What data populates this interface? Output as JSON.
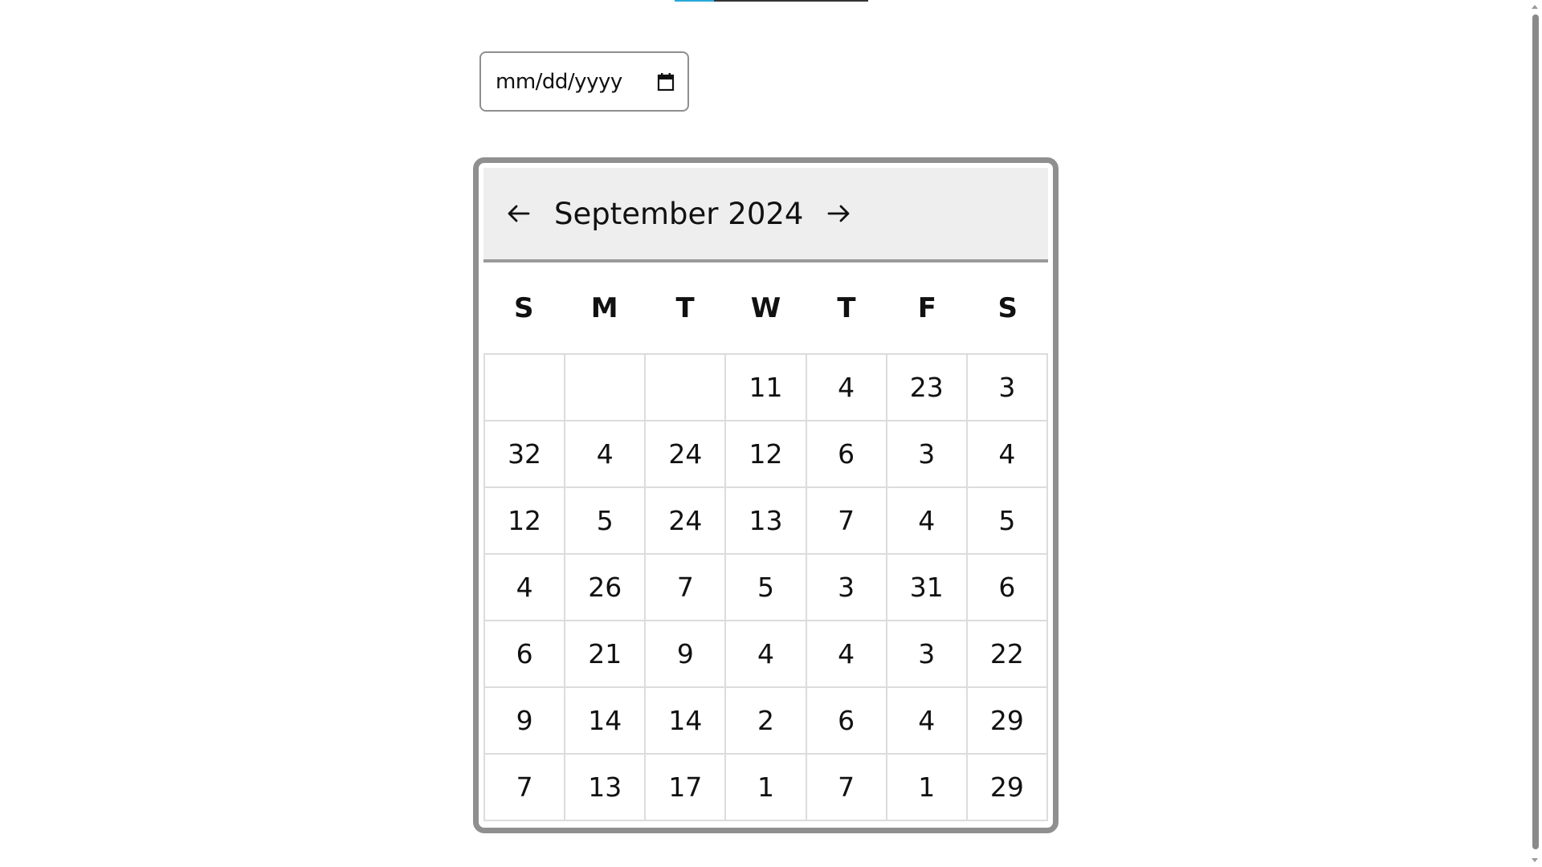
{
  "date_input": {
    "placeholder": "mm/dd/yyyy",
    "icon": "calendar-icon"
  },
  "calendar": {
    "month_label": "September 2024",
    "prev_icon": "arrow-left-icon",
    "next_icon": "arrow-right-icon",
    "weekdays": [
      "S",
      "M",
      "T",
      "W",
      "T",
      "F",
      "S"
    ],
    "weeks": [
      [
        "",
        "",
        "",
        "11",
        "4",
        "23",
        "3"
      ],
      [
        "32",
        "4",
        "24",
        "12",
        "6",
        "3",
        "4"
      ],
      [
        "12",
        "5",
        "24",
        "13",
        "7",
        "4",
        "5"
      ],
      [
        "4",
        "26",
        "7",
        "5",
        "3",
        "31",
        "6"
      ],
      [
        "6",
        "21",
        "9",
        "4",
        "4",
        "3",
        "22"
      ],
      [
        "9",
        "14",
        "14",
        "2",
        "6",
        "4",
        "29"
      ],
      [
        "7",
        "13",
        "17",
        "1",
        "7",
        "1",
        "29"
      ]
    ]
  },
  "colors": {
    "accent": "#2aa8d8",
    "border": "#8f8f8f",
    "header_bg": "#eeeeee"
  }
}
